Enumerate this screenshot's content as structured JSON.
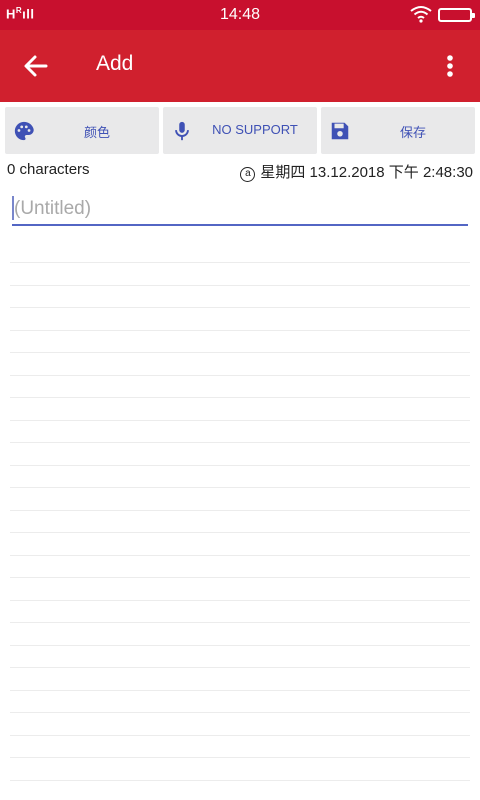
{
  "status_bar": {
    "signal": "H",
    "signal_sup": "R",
    "time": "14:48"
  },
  "app_bar": {
    "title": "Add",
    "back_icon": "arrow-back-icon",
    "more_icon": "more-vert-icon"
  },
  "toolbar": {
    "buttons": [
      {
        "label": "颜色",
        "icon": "palette-icon"
      },
      {
        "label": "NO SUPPORT",
        "icon": "microphone-icon"
      },
      {
        "label": "保存",
        "icon": "save-icon"
      }
    ]
  },
  "note_meta": {
    "char_count": "0 characters",
    "auto_icon": "a",
    "datetime": "星期四 13.12.2018 下午 2:48:30"
  },
  "editor": {
    "title_placeholder": "(Untitled)",
    "title_value": ""
  },
  "colors": {
    "status_bar": "#c8102e",
    "app_bar": "#d0202e",
    "accent": "#3f51b5",
    "button_bg": "#e9e9ea"
  }
}
